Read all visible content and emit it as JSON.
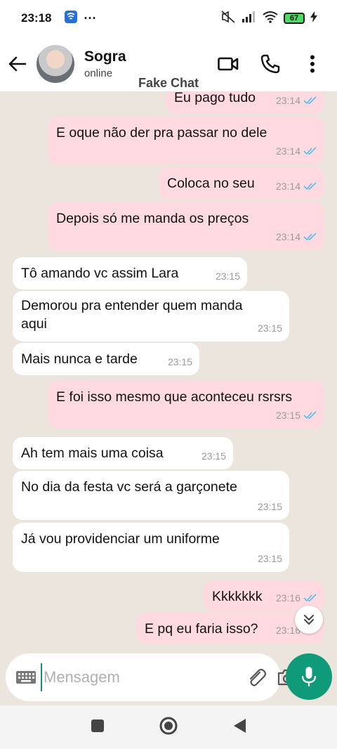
{
  "status_bar": {
    "time": "23:18",
    "dots": "···",
    "battery": "67"
  },
  "header": {
    "contact_name": "Sogra",
    "contact_status": "online",
    "watermark": "Fake Chat"
  },
  "messages": [
    {
      "dir": "out",
      "text": "Eu pago tudo",
      "time": "23:14"
    },
    {
      "dir": "out",
      "text": "E oque não der pra passar no dele",
      "time": "23:14"
    },
    {
      "dir": "out",
      "text": "Coloca no seu",
      "time": "23:14"
    },
    {
      "dir": "out",
      "text": "Depois só me manda os preços",
      "time": "23:14"
    },
    {
      "dir": "in",
      "text": "Tô amando vc assim Lara",
      "time": "23:15"
    },
    {
      "dir": "in",
      "text": "Demorou pra entender quem manda aqui",
      "time": "23:15"
    },
    {
      "dir": "in",
      "text": "Mais nunca e tarde",
      "time": "23:15"
    },
    {
      "dir": "out",
      "text": "E foi isso mesmo que aconteceu rsrsrs",
      "time": "23:15"
    },
    {
      "dir": "in",
      "text": "Ah tem mais uma coisa",
      "time": "23:15"
    },
    {
      "dir": "in",
      "text": "No dia da festa vc será a garçonete",
      "time": "23:15"
    },
    {
      "dir": "in",
      "text": "Já vou providenciar um uniforme",
      "time": "23:15"
    },
    {
      "dir": "out",
      "text": "Kkkkkkk",
      "time": "23:16"
    },
    {
      "dir": "out",
      "text": "E pq eu faria isso?",
      "time": "23:16"
    }
  ],
  "composer": {
    "placeholder": "Mensagem"
  },
  "colors": {
    "outgoing_bubble": "#ffdbe1",
    "incoming_bubble": "#ffffff",
    "tick_read": "#53bdeb",
    "accent": "#0f9b7a"
  }
}
